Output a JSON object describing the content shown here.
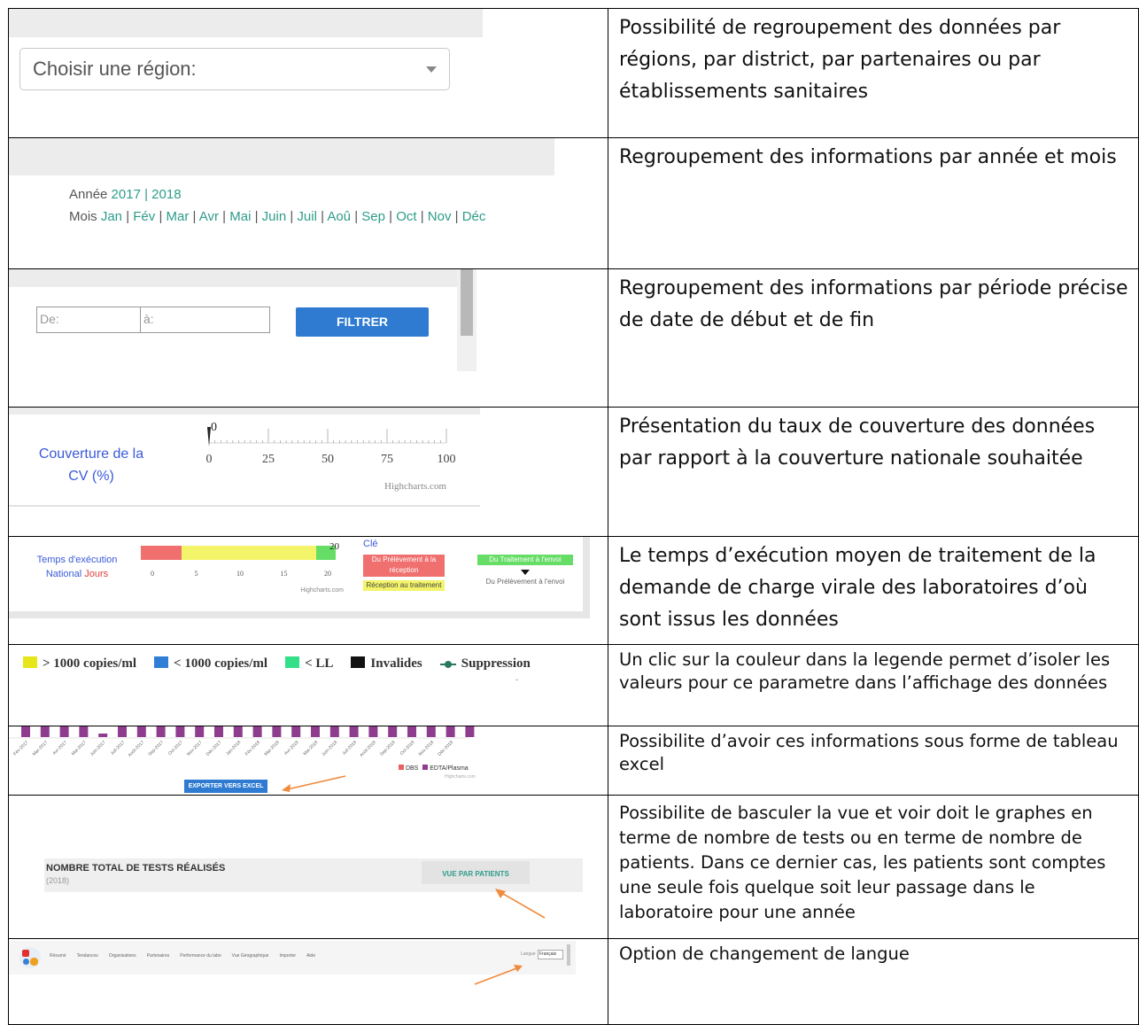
{
  "rows": [
    {
      "description": "Possibilité de regroupement des données par régions, par district, par partenaires ou par établissements sanitaires",
      "region_select": {
        "value": "Choisir une région:"
      }
    },
    {
      "description": "Regroupement des informations par année et mois",
      "year_label": "Année",
      "years": [
        "2017",
        "2018"
      ],
      "month_label": "Mois",
      "months": [
        "Jan",
        "Fév",
        "Mar",
        "Avr",
        "Mai",
        "Juin",
        "Juil",
        "Aoû",
        "Sep",
        "Oct",
        "Nov",
        "Déc"
      ]
    },
    {
      "description": "Regroupement des informations par période précise de date de début et de fin",
      "from_placeholder": "De:",
      "to_placeholder": "à:",
      "filter_button": "FILTRER"
    },
    {
      "description": "Présentation du taux de couverture des données par rapport à la couverture nationale souhaitée",
      "gauge_label_1": "Couverture de la",
      "gauge_label_2": "CV (%)",
      "gauge_value": "0",
      "gauge_ticks": [
        "0",
        "25",
        "50",
        "75",
        "100"
      ],
      "credit": "Highcharts.com"
    },
    {
      "description": "Le temps d’exécution moyen de traitement de la demande de charge virale des laboratoires d’où sont issus les données",
      "tat_label_1": "Temps d'exécution",
      "tat_label_2a": "National",
      "tat_label_2b": "Jours",
      "tat_value": "20",
      "tat_ticks": [
        "0",
        "5",
        "10",
        "15",
        "20"
      ],
      "credit": "Highcharts.com",
      "key_title": "Clé",
      "key_items": [
        "Du Prélèvement à la réception",
        "Réception au traitement",
        "Du Traitement à l'envoi",
        "Du Prélèvement à l'envoi"
      ]
    },
    {
      "description": "Un clic sur la couleur dans la legende permet d’isoler les valeurs pour ce parametre dans l’affichage des données",
      "legend": [
        {
          "label": "> 1000 copies/ml",
          "color": "#e6e61a"
        },
        {
          "label": "< 1000 copies/ml",
          "color": "#2f7fd6"
        },
        {
          "label": "< LL",
          "color": "#33e08a"
        },
        {
          "label": "Invalides",
          "color": "#111111"
        },
        {
          "label": "Suppression",
          "color": "#2a7a5a"
        }
      ]
    },
    {
      "description": "Possibilite d’avoir ces informations sous forme de tableau excel",
      "export_button": "EXPORTER VERS EXCEL",
      "legend": [
        {
          "label": "DBS",
          "color": "#e86060"
        },
        {
          "label": "EDTA/Plasma",
          "color": "#8e3d8e"
        }
      ],
      "x_labels": [
        "Fév-2017",
        "Mar-2017",
        "Avr-2017",
        "Mai-2017",
        "Juin-2017",
        "Juil-2017",
        "Août-2017",
        "Sep-2017",
        "Oct-2017",
        "Nov-2017",
        "Déc-2017",
        "Jan-2018",
        "Fév-2018",
        "Mar-2018",
        "Avr-2018",
        "Mai-2018",
        "Juin-2018",
        "Juil-2018",
        "Août-2018",
        "Sep-2018",
        "Oct-2018",
        "Nov-2018",
        "Déc-2018"
      ],
      "credit": "Highcharts.com",
      "bar_color": "#8e3d8e"
    },
    {
      "description": "Possibilite de basculer la vue et voir doit le graphes en terme de nombre de tests ou en terme de nombre de patients. Dans ce dernier cas, les patients sont comptes une seule fois quelque soit leur passage dans le laboratoire pour une année",
      "panel_title": "NOMBRE TOTAL DE TESTS RÉALISÉS",
      "panel_sub": "(2018)",
      "toggle_button": "VUE PAR PATIENTS"
    },
    {
      "description": "Option de changement de langue",
      "nav_items": [
        "Résumé",
        "Tendances",
        "Organisations",
        "Partenaires",
        "Performance du labo",
        "Vue Géographique",
        "Importer",
        "Aide"
      ],
      "lang_label": "Langue",
      "lang_value": "Français"
    }
  ],
  "colors": {
    "accent_teal": "#2e9c8a",
    "button_blue": "#2e7bd1",
    "arrow_orange": "#f08a3c"
  }
}
